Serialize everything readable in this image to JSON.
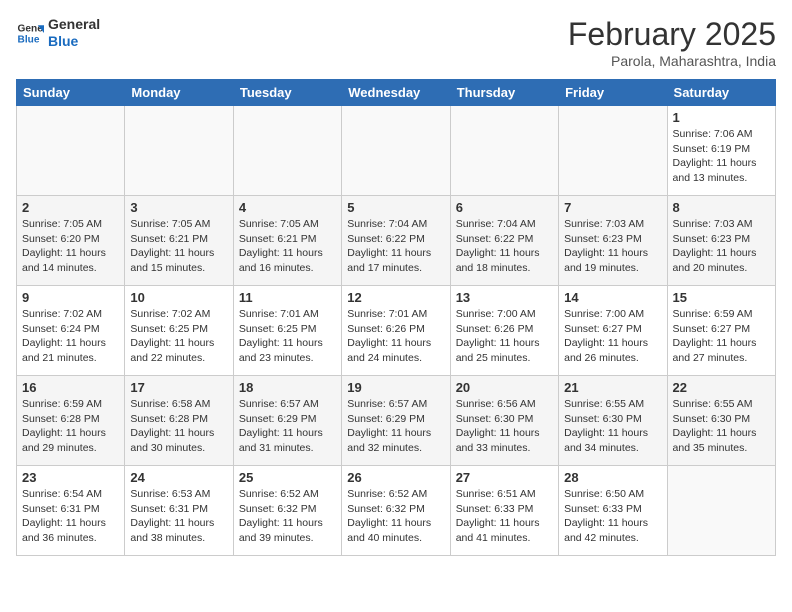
{
  "header": {
    "logo_line1": "General",
    "logo_line2": "Blue",
    "title": "February 2025",
    "subtitle": "Parola, Maharashtra, India"
  },
  "weekdays": [
    "Sunday",
    "Monday",
    "Tuesday",
    "Wednesday",
    "Thursday",
    "Friday",
    "Saturday"
  ],
  "weeks": [
    [
      {
        "day": "",
        "info": ""
      },
      {
        "day": "",
        "info": ""
      },
      {
        "day": "",
        "info": ""
      },
      {
        "day": "",
        "info": ""
      },
      {
        "day": "",
        "info": ""
      },
      {
        "day": "",
        "info": ""
      },
      {
        "day": "1",
        "info": "Sunrise: 7:06 AM\nSunset: 6:19 PM\nDaylight: 11 hours\nand 13 minutes."
      }
    ],
    [
      {
        "day": "2",
        "info": "Sunrise: 7:05 AM\nSunset: 6:20 PM\nDaylight: 11 hours\nand 14 minutes."
      },
      {
        "day": "3",
        "info": "Sunrise: 7:05 AM\nSunset: 6:21 PM\nDaylight: 11 hours\nand 15 minutes."
      },
      {
        "day": "4",
        "info": "Sunrise: 7:05 AM\nSunset: 6:21 PM\nDaylight: 11 hours\nand 16 minutes."
      },
      {
        "day": "5",
        "info": "Sunrise: 7:04 AM\nSunset: 6:22 PM\nDaylight: 11 hours\nand 17 minutes."
      },
      {
        "day": "6",
        "info": "Sunrise: 7:04 AM\nSunset: 6:22 PM\nDaylight: 11 hours\nand 18 minutes."
      },
      {
        "day": "7",
        "info": "Sunrise: 7:03 AM\nSunset: 6:23 PM\nDaylight: 11 hours\nand 19 minutes."
      },
      {
        "day": "8",
        "info": "Sunrise: 7:03 AM\nSunset: 6:23 PM\nDaylight: 11 hours\nand 20 minutes."
      }
    ],
    [
      {
        "day": "9",
        "info": "Sunrise: 7:02 AM\nSunset: 6:24 PM\nDaylight: 11 hours\nand 21 minutes."
      },
      {
        "day": "10",
        "info": "Sunrise: 7:02 AM\nSunset: 6:25 PM\nDaylight: 11 hours\nand 22 minutes."
      },
      {
        "day": "11",
        "info": "Sunrise: 7:01 AM\nSunset: 6:25 PM\nDaylight: 11 hours\nand 23 minutes."
      },
      {
        "day": "12",
        "info": "Sunrise: 7:01 AM\nSunset: 6:26 PM\nDaylight: 11 hours\nand 24 minutes."
      },
      {
        "day": "13",
        "info": "Sunrise: 7:00 AM\nSunset: 6:26 PM\nDaylight: 11 hours\nand 25 minutes."
      },
      {
        "day": "14",
        "info": "Sunrise: 7:00 AM\nSunset: 6:27 PM\nDaylight: 11 hours\nand 26 minutes."
      },
      {
        "day": "15",
        "info": "Sunrise: 6:59 AM\nSunset: 6:27 PM\nDaylight: 11 hours\nand 27 minutes."
      }
    ],
    [
      {
        "day": "16",
        "info": "Sunrise: 6:59 AM\nSunset: 6:28 PM\nDaylight: 11 hours\nand 29 minutes."
      },
      {
        "day": "17",
        "info": "Sunrise: 6:58 AM\nSunset: 6:28 PM\nDaylight: 11 hours\nand 30 minutes."
      },
      {
        "day": "18",
        "info": "Sunrise: 6:57 AM\nSunset: 6:29 PM\nDaylight: 11 hours\nand 31 minutes."
      },
      {
        "day": "19",
        "info": "Sunrise: 6:57 AM\nSunset: 6:29 PM\nDaylight: 11 hours\nand 32 minutes."
      },
      {
        "day": "20",
        "info": "Sunrise: 6:56 AM\nSunset: 6:30 PM\nDaylight: 11 hours\nand 33 minutes."
      },
      {
        "day": "21",
        "info": "Sunrise: 6:55 AM\nSunset: 6:30 PM\nDaylight: 11 hours\nand 34 minutes."
      },
      {
        "day": "22",
        "info": "Sunrise: 6:55 AM\nSunset: 6:30 PM\nDaylight: 11 hours\nand 35 minutes."
      }
    ],
    [
      {
        "day": "23",
        "info": "Sunrise: 6:54 AM\nSunset: 6:31 PM\nDaylight: 11 hours\nand 36 minutes."
      },
      {
        "day": "24",
        "info": "Sunrise: 6:53 AM\nSunset: 6:31 PM\nDaylight: 11 hours\nand 38 minutes."
      },
      {
        "day": "25",
        "info": "Sunrise: 6:52 AM\nSunset: 6:32 PM\nDaylight: 11 hours\nand 39 minutes."
      },
      {
        "day": "26",
        "info": "Sunrise: 6:52 AM\nSunset: 6:32 PM\nDaylight: 11 hours\nand 40 minutes."
      },
      {
        "day": "27",
        "info": "Sunrise: 6:51 AM\nSunset: 6:33 PM\nDaylight: 11 hours\nand 41 minutes."
      },
      {
        "day": "28",
        "info": "Sunrise: 6:50 AM\nSunset: 6:33 PM\nDaylight: 11 hours\nand 42 minutes."
      },
      {
        "day": "",
        "info": ""
      }
    ]
  ]
}
